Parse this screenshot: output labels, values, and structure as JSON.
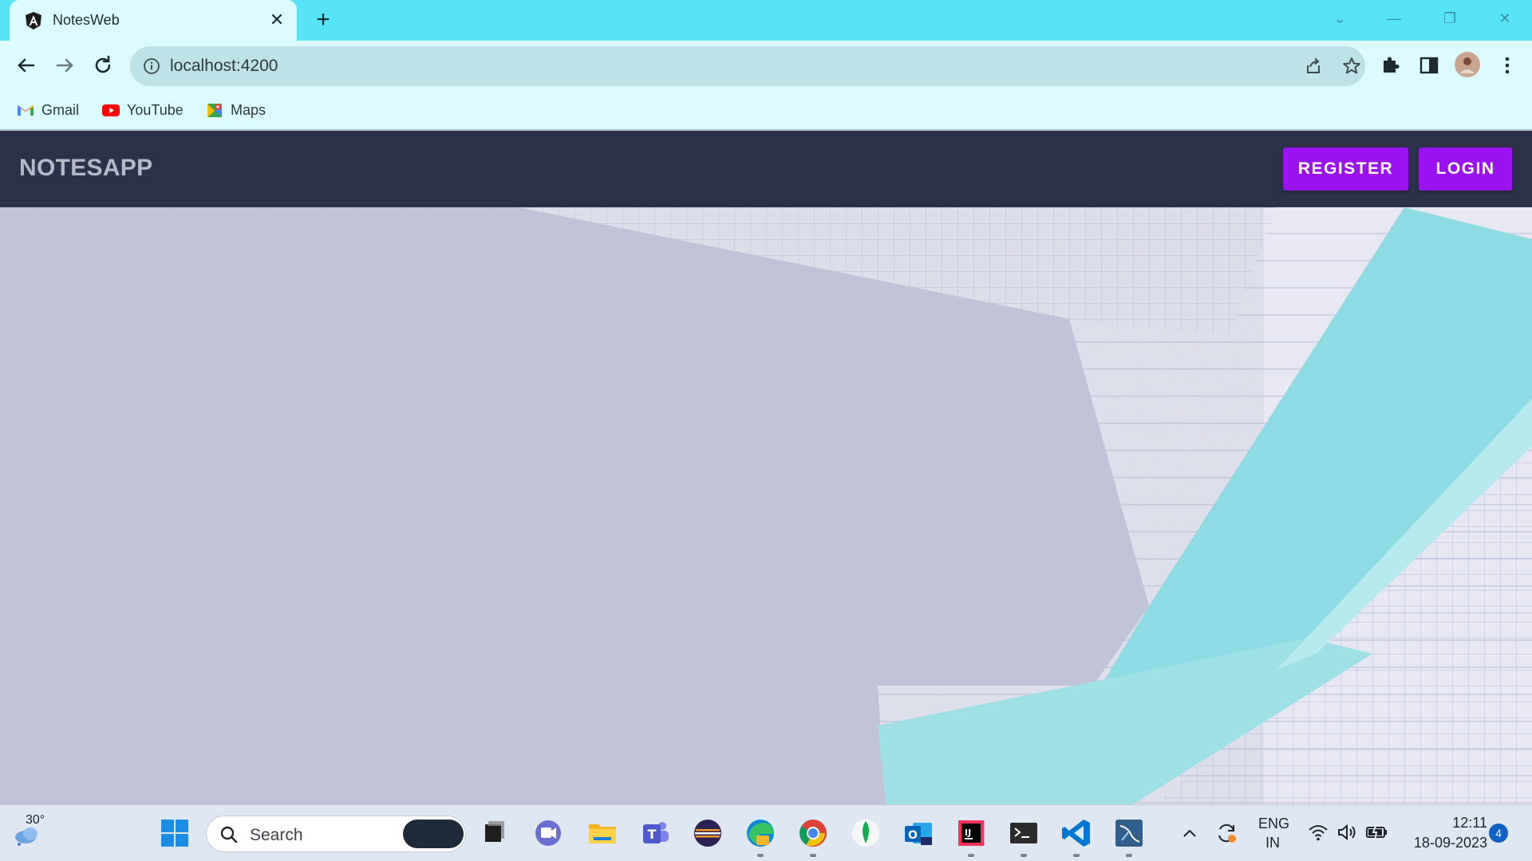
{
  "browser": {
    "tab_title": "NotesWeb",
    "url": "localhost:4200",
    "bookmarks": [
      {
        "label": "Gmail",
        "icon": "gmail-icon"
      },
      {
        "label": "YouTube",
        "icon": "youtube-icon"
      },
      {
        "label": "Maps",
        "icon": "maps-icon"
      }
    ]
  },
  "app": {
    "brand": "NOTESAPP",
    "register_label": "REGISTER",
    "login_label": "LOGIN",
    "accent_color": "#9b12f0",
    "nav_color": "#2b3249"
  },
  "taskbar": {
    "weather": "30°",
    "search_placeholder": "Search",
    "lang_line1": "ENG",
    "lang_line2": "IN",
    "time": "12:11",
    "date": "18-09-2023",
    "notification_count": "4"
  }
}
